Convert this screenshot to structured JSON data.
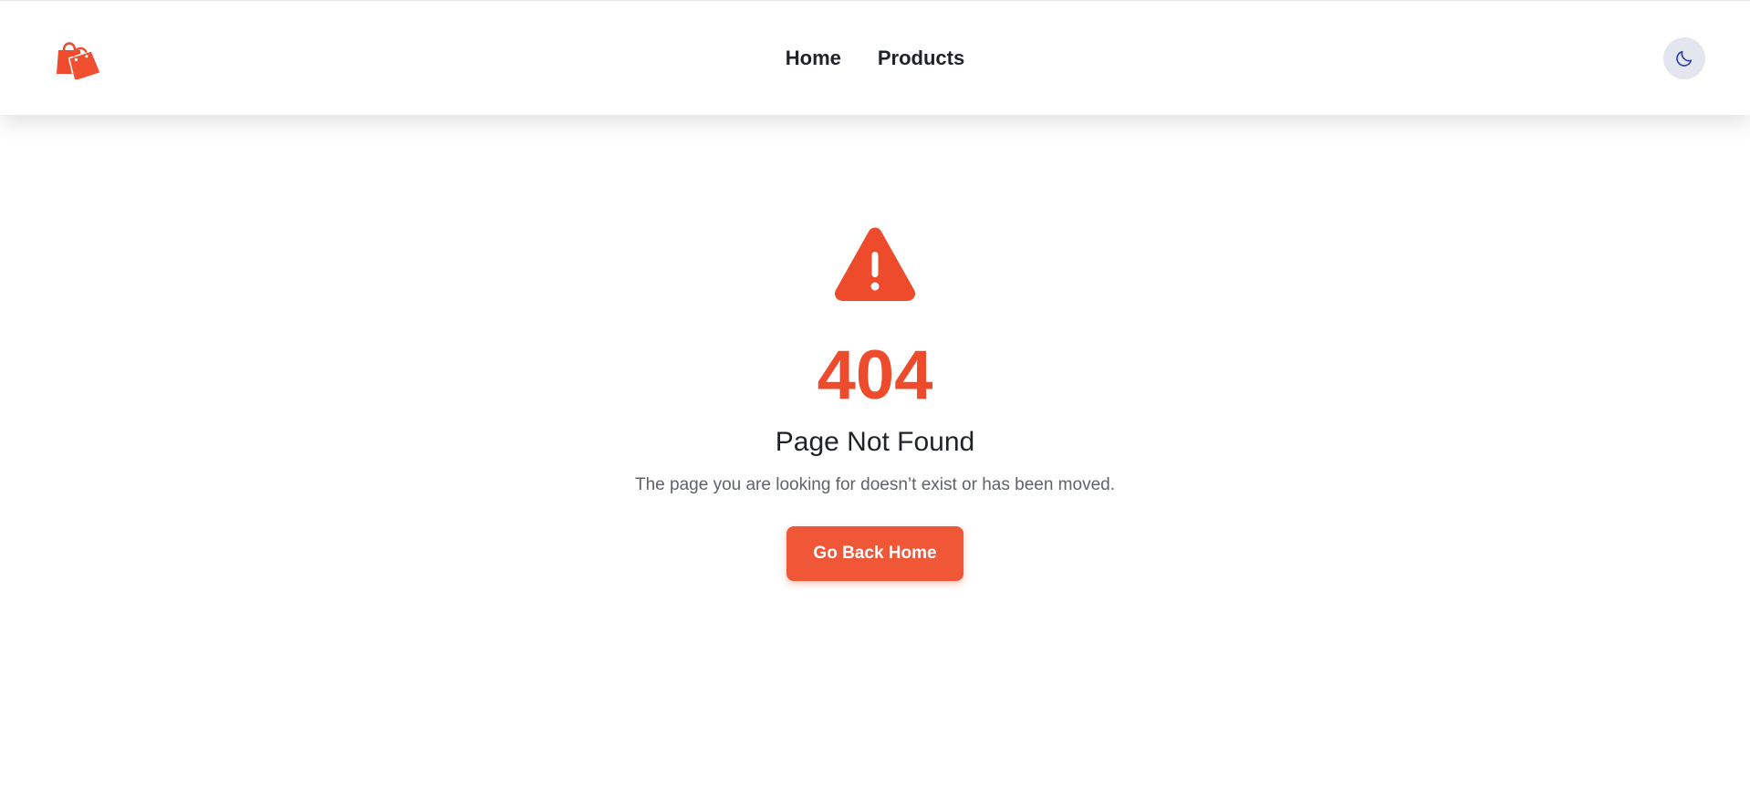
{
  "header": {
    "logo_icon": "shopping-bags-icon",
    "nav": {
      "home": "Home",
      "products": "Products"
    },
    "theme_toggle_icon": "moon-icon"
  },
  "error": {
    "icon": "warning-triangle-icon",
    "code": "404",
    "title": "Page Not Found",
    "message": "The page you are looking for doesn’t exist or has been moved.",
    "button_label": "Go Back Home"
  },
  "colors": {
    "accent": "#ef5737",
    "code_color": "#ee4a2c",
    "text": "#1f2329",
    "muted": "#5f6368",
    "toggle_bg": "#e3e6ee",
    "moon": "#2c3ea8"
  }
}
